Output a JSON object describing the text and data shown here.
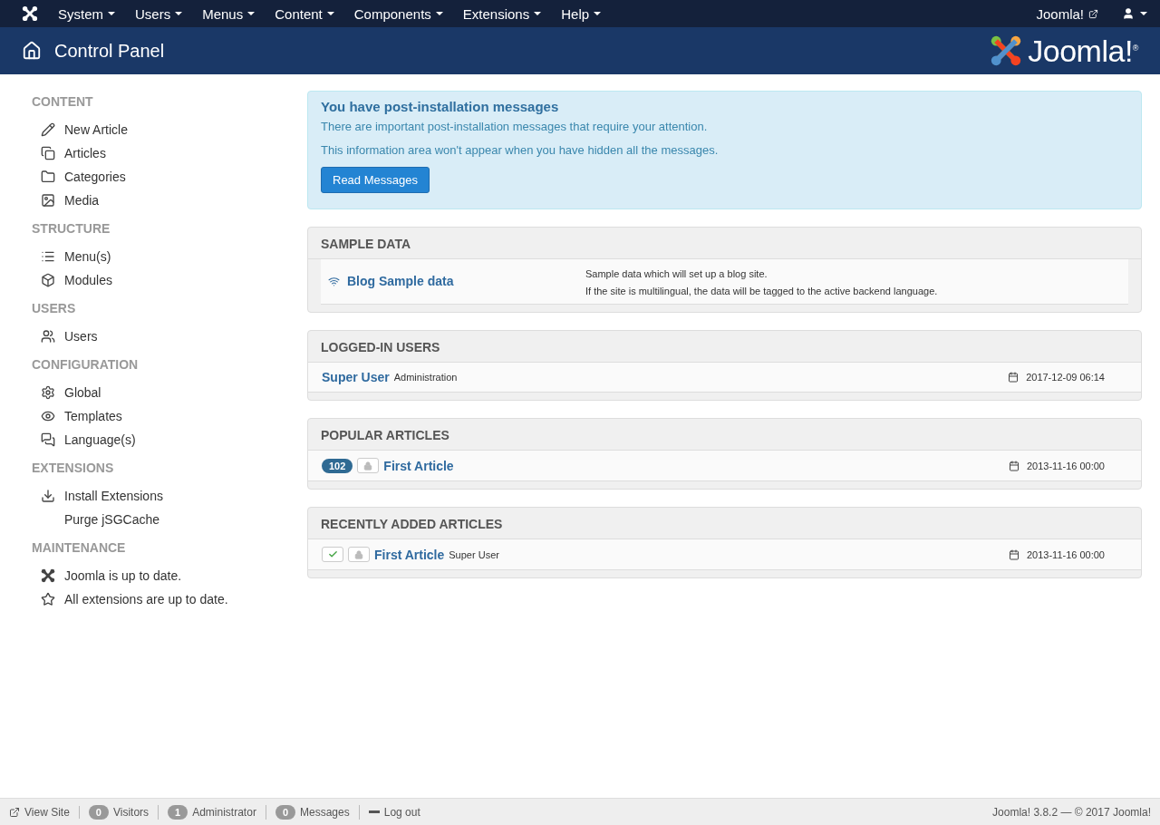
{
  "top_menu": {
    "items": [
      "System",
      "Users",
      "Menus",
      "Content",
      "Components",
      "Extensions",
      "Help"
    ],
    "site_link": "Joomla!"
  },
  "header": {
    "title": "Control Panel",
    "logo": "Joomla!$^{®}$"
  },
  "sidebar": [
    {
      "heading": "CONTENT",
      "items": [
        "New Article",
        "Articles",
        "Categories",
        "Media"
      ]
    },
    {
      "heading": "STRUCTURE",
      "items": [
        "Menu(s)",
        "Modules"
      ]
    },
    {
      "heading": "USERS",
      "items": [
        "Users"
      ]
    },
    {
      "heading": "CONFIGURATION",
      "items": [
        "Global",
        "Templates",
        "Language(s)"
      ]
    },
    {
      "heading": "EXTENSIONS",
      "items": [
        "Install Extensions",
        "Purge jSGCache"
      ]
    },
    {
      "heading": "MAINTENANCE",
      "items": [
        "Joomla is up to date.",
        "All extensions are up to date."
      ]
    }
  ],
  "alert": {
    "title": "You have post-installation messages",
    "lines": [
      "There are important post-installation messages that require your attention.",
      "This information area won't appear when you have hidden all the messages."
    ],
    "button": "Read Messages"
  },
  "sample_data": {
    "heading": "SAMPLE DATA",
    "title": "Blog Sample data",
    "lines": [
      "Sample data which will set up a blog site.",
      "If the site is multilingual, the data will be tagged to the active backend language."
    ]
  },
  "panels": [
    {
      "heading": "LOGGED-IN USERS",
      "rows": [
        {
          "kind": "user",
          "title": "Super User",
          "meta": "Administration",
          "date": "2017-12-09 06:14"
        }
      ]
    },
    {
      "heading": "POPULAR ARTICLES",
      "rows": [
        {
          "kind": "popular",
          "hits": "102",
          "title": "First Article",
          "date": "2013-11-16 00:00"
        }
      ]
    },
    {
      "heading": "RECENTLY ADDED ARTICLES",
      "rows": [
        {
          "kind": "recent",
          "published": true,
          "title": "First Article",
          "meta": "Super User",
          "date": "2013-11-16 00:00"
        }
      ]
    }
  ],
  "status_bar": {
    "items": [
      {
        "kind": "link",
        "label": "View Site"
      },
      {
        "kind": "count",
        "count": "0",
        "label": "Visitors"
      },
      {
        "kind": "count",
        "count": "1",
        "label": "Administrator"
      },
      {
        "kind": "count",
        "count": "0",
        "label": "Messages"
      },
      {
        "kind": "logout",
        "label": "Log out"
      }
    ],
    "version": "Joomla! 3.8.2 — © 2017 Joomla!"
  }
}
